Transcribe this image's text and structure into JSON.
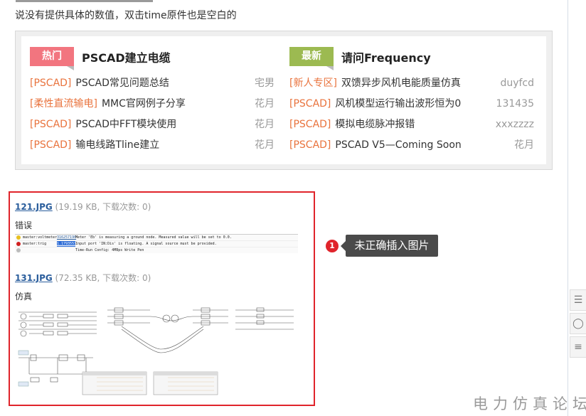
{
  "intro_text": "说没有提供具体的数值，双击time原件也是空白的",
  "panel": {
    "left": {
      "tag": "热门",
      "title": "PSCAD建立电缆",
      "rows": [
        {
          "cat": "[PSCAD]",
          "title": "PSCAD常见问题总结",
          "author": "宅男"
        },
        {
          "cat": "[柔性直流输电]",
          "title": "MMC官网例子分享",
          "author": "花月"
        },
        {
          "cat": "[PSCAD]",
          "title": "PSCAD中FFT模块使用",
          "author": "花月"
        },
        {
          "cat": "[PSCAD]",
          "title": "输电线路Tline建立",
          "author": "花月"
        }
      ]
    },
    "right": {
      "tag": "最新",
      "title": "请问Frequency",
      "rows": [
        {
          "cat": "[新人专区]",
          "title": "双馈异步风机电能质量仿真",
          "author": "duyfcd"
        },
        {
          "cat": "[PSCAD]",
          "title": "风机模型运行输出波形恒为0",
          "author": "131435"
        },
        {
          "cat": "[PSCAD]",
          "title": "模拟电缆脉冲报错",
          "author": "xxxzzzz"
        },
        {
          "cat": "[PSCAD]",
          "title": "PSCAD V5—Coming Soon",
          "author": "花月"
        }
      ]
    }
  },
  "attachments": [
    {
      "name": "121.JPG",
      "meta": "(19.19 KB, 下载次数: 0)",
      "desc": "错误"
    },
    {
      "name": "131.JPG",
      "meta": "(72.35 KB, 下载次数: 0)",
      "desc": "仿真"
    }
  ],
  "log_rows": [
    {
      "source": "master:voltmeter",
      "id": "316257190",
      "msg": "Meter 'Eb' is measuring a ground node. Measured value will be set to 0.0."
    },
    {
      "source": "master:trig",
      "id": "1.17935533",
      "msg": "Input port 'IN:Dis' is floating. A signal source must be provided."
    },
    {
      "source": "",
      "id": "",
      "msg": "Time-Run Config: 4MBps Write Pen"
    }
  ],
  "annotation": {
    "number": "1",
    "text": "未正确插入图片"
  },
  "watermark": "电力仿真论坛",
  "colors": {
    "hot": "#f2757f",
    "new": "#9cba51",
    "category": "#e9733d",
    "highlight_border": "#e0242b",
    "link": "#2a5d9c"
  }
}
